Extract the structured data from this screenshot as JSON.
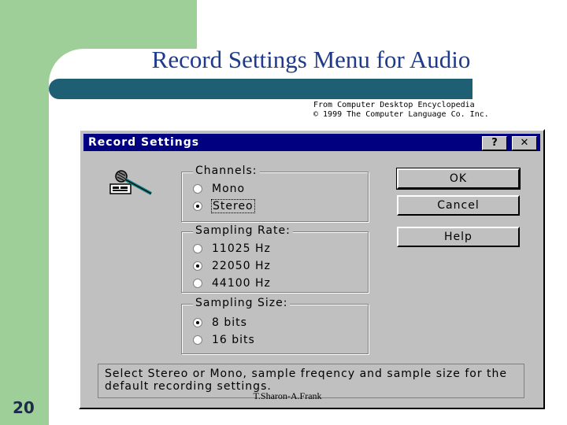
{
  "slide": {
    "title": "Record Settings Menu for Audio",
    "number": "20",
    "footer": "T.Sharon-A.Frank"
  },
  "credit": {
    "line1": "From Computer Desktop Encyclopedia",
    "line2": "© 1999 The Computer Language Co. Inc."
  },
  "dialog": {
    "title": "Record Settings",
    "help_glyph": "?",
    "close_glyph": "✕",
    "channels": {
      "label": "Channels:",
      "options": [
        {
          "label": "Mono",
          "selected": false
        },
        {
          "label": "Stereo",
          "selected": true
        }
      ]
    },
    "sampling_rate": {
      "label": "Sampling Rate:",
      "options": [
        {
          "label": "11025 Hz",
          "selected": false
        },
        {
          "label": "22050 Hz",
          "selected": true
        },
        {
          "label": "44100 Hz",
          "selected": false
        }
      ]
    },
    "sampling_size": {
      "label": "Sampling Size:",
      "options": [
        {
          "label": "8 bits",
          "selected": true
        },
        {
          "label": "16 bits",
          "selected": false
        }
      ]
    },
    "buttons": {
      "ok": "OK",
      "cancel": "Cancel",
      "help": "Help"
    },
    "status": "Select Stereo or Mono, sample freqency and sample size for the default recording settings.",
    "icon": "microphone-icon"
  }
}
